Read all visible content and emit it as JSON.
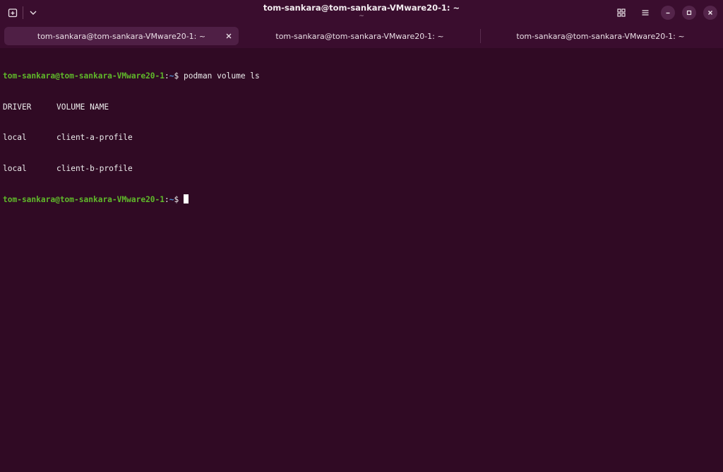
{
  "window": {
    "title": "tom-sankara@tom-sankara-VMware20-1: ~",
    "subtitle": "~"
  },
  "tabs": [
    {
      "label": "tom-sankara@tom-sankara-VMware20-1: ~",
      "active": true
    },
    {
      "label": "tom-sankara@tom-sankara-VMware20-1: ~",
      "active": false
    },
    {
      "label": "tom-sankara@tom-sankara-VMware20-1: ~",
      "active": false
    }
  ],
  "icons": {
    "new_tab": "new-tab-icon",
    "tab_menu": "chevron-down-icon",
    "tab_overview": "grid-icon",
    "main_menu": "hamburger-icon",
    "minimize": "minimize-icon",
    "maximize": "maximize-icon",
    "close": "close-icon",
    "tab_close": "close-icon"
  },
  "terminal": {
    "prompt_user_host": "tom-sankara@tom-sankara-VMware20-1",
    "prompt_colon": ":",
    "prompt_path": "~",
    "prompt_symbol": "$ ",
    "command": "podman volume ls",
    "table_header": [
      "DRIVER",
      "VOLUME NAME"
    ],
    "rows": [
      [
        "local",
        "client-a-profile"
      ],
      [
        "local",
        "client-b-profile"
      ]
    ]
  },
  "colors": {
    "background": "#300a24",
    "header": "#3a0d2e",
    "prompt_user": "#5fb82a",
    "prompt_path": "#4f8fd1",
    "text": "#ececec"
  }
}
